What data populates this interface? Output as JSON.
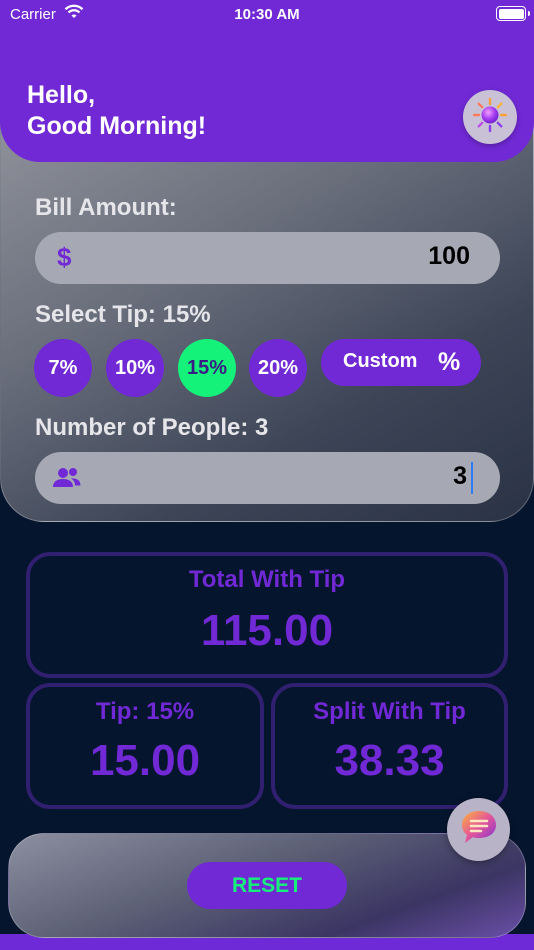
{
  "status_bar": {
    "carrier": "Carrier",
    "time": "10:30 AM"
  },
  "header": {
    "greeting_line1": "Hello,",
    "greeting_line2": "Good Morning!",
    "theme_icon": "sun-icon"
  },
  "bill": {
    "label": "Bill Amount:",
    "currency_symbol": "$",
    "value": "100"
  },
  "tip": {
    "label": "Select Tip: 15%",
    "options": [
      "7%",
      "10%",
      "15%",
      "20%"
    ],
    "selected": "15%",
    "custom_label": "Custom",
    "custom_symbol": "%"
  },
  "people": {
    "label": "Number of People: 3",
    "icon": "people-icon",
    "value": "3"
  },
  "results": {
    "total_title": "Total With Tip",
    "total_value": "115.00",
    "tip_title": "Tip: 15%",
    "tip_value": "15.00",
    "split_title": "Split With Tip",
    "split_value": "38.33"
  },
  "chat": {
    "icon": "chat-bubble-icon"
  },
  "reset_label": "RESET",
  "colors": {
    "brand_purple": "#7129d6",
    "accent_green": "#15f27a",
    "dark_bg": "#05152e",
    "border_purple": "#311f70"
  }
}
